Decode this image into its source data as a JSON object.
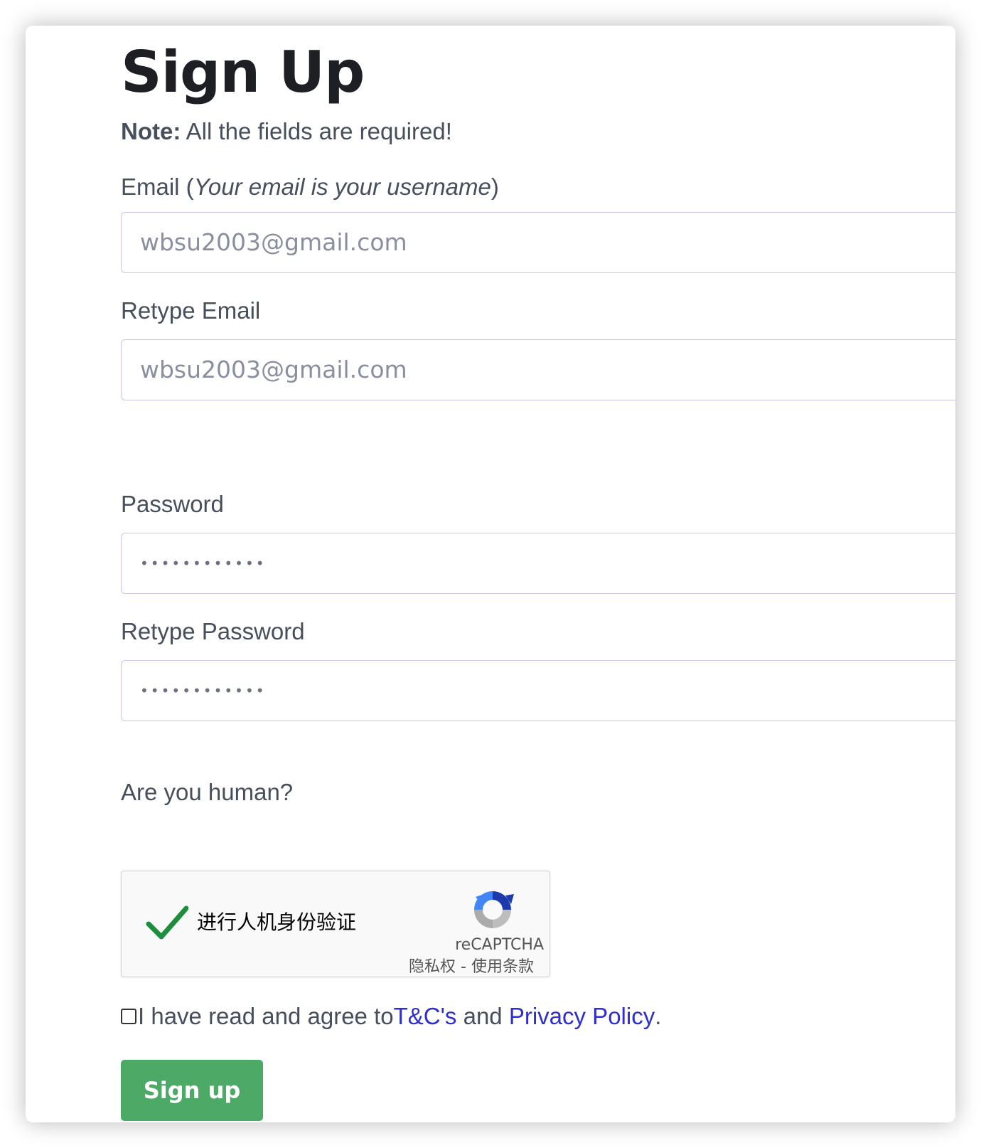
{
  "page": {
    "title": "Sign Up",
    "note_bold": "Note:",
    "note_text": " All the fields are required!"
  },
  "fields": {
    "email_label": "Email (",
    "email_label_hint": "Your email is your username",
    "email_label_close": ")",
    "email_value": "wbsu2003@gmail.com",
    "retype_email_label": "Retype Email",
    "retype_email_value": "wbsu2003@gmail.com",
    "password_label": "Password",
    "password_value": "••••••••••••",
    "retype_password_label": "Retype Password",
    "retype_password_value": "••••••••••••"
  },
  "captcha": {
    "question": "Are you human?",
    "label": "进行人机身份验证",
    "brand": "reCAPTCHA",
    "privacy": "隐私权",
    "separator": " - ",
    "terms": "使用条款",
    "checked": true,
    "icons": {
      "check": "checkmark-icon",
      "logo": "recaptcha-logo-icon"
    }
  },
  "agree": {
    "text": "I have read and agree to",
    "tc_link": "T&C's",
    "and": " and ",
    "privacy_link": "Privacy Policy",
    "period": ".",
    "checked": false
  },
  "submit": {
    "label": "Sign up"
  },
  "colors": {
    "button": "#4caa66",
    "link": "#2f2fcf",
    "input_border": "#c9c8ec",
    "check": "#1e8e3e"
  }
}
